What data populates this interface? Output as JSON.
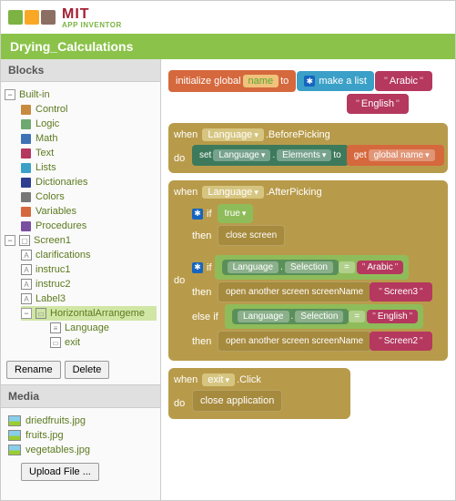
{
  "logo": {
    "mit": "MIT",
    "sub": "APP INVENTOR"
  },
  "topbar_title": "Drying_Calculations",
  "panels": {
    "blocks": "Blocks",
    "media": "Media"
  },
  "tree": {
    "builtin": "Built-in",
    "categories": {
      "control": "Control",
      "logic": "Logic",
      "math": "Math",
      "text": "Text",
      "lists": "Lists",
      "dictionaries": "Dictionaries",
      "colors": "Colors",
      "variables": "Variables",
      "procedures": "Procedures"
    },
    "screen1": "Screen1",
    "components": {
      "clarifications": "clarifications",
      "instruc1": "instruc1",
      "instruc2": "instruc2",
      "label3": "Label3",
      "horiz": "HorizontalArrangeme",
      "language": "Language",
      "exit": "exit"
    }
  },
  "buttons": {
    "rename": "Rename",
    "delete": "Delete",
    "upload": "Upload File ..."
  },
  "media_files": [
    "driedfruits.jpg",
    "fruits.jpg",
    "vegetables.jpg"
  ],
  "blocks": {
    "init_global": "initialize global",
    "name": "name",
    "to": "to",
    "make_list": "make a list",
    "arabic": "Arabic",
    "english": "English",
    "when": "when",
    "language": "Language",
    "before_picking": ".BeforePicking",
    "after_picking": ".AfterPicking",
    "do": "do",
    "set": "set",
    "elements": "Elements",
    "get": "get",
    "global_name": "global name",
    "if": "if",
    "true": "true",
    "then": "then",
    "else_if": "else if",
    "close_screen": "close screen",
    "selection": "Selection",
    "eq": "=",
    "open_screen": "open another screen  screenName",
    "screen3": "Screen3",
    "screen2": "Screen2",
    "exit": "exit",
    "click": ".Click",
    "close_app": "close application"
  }
}
